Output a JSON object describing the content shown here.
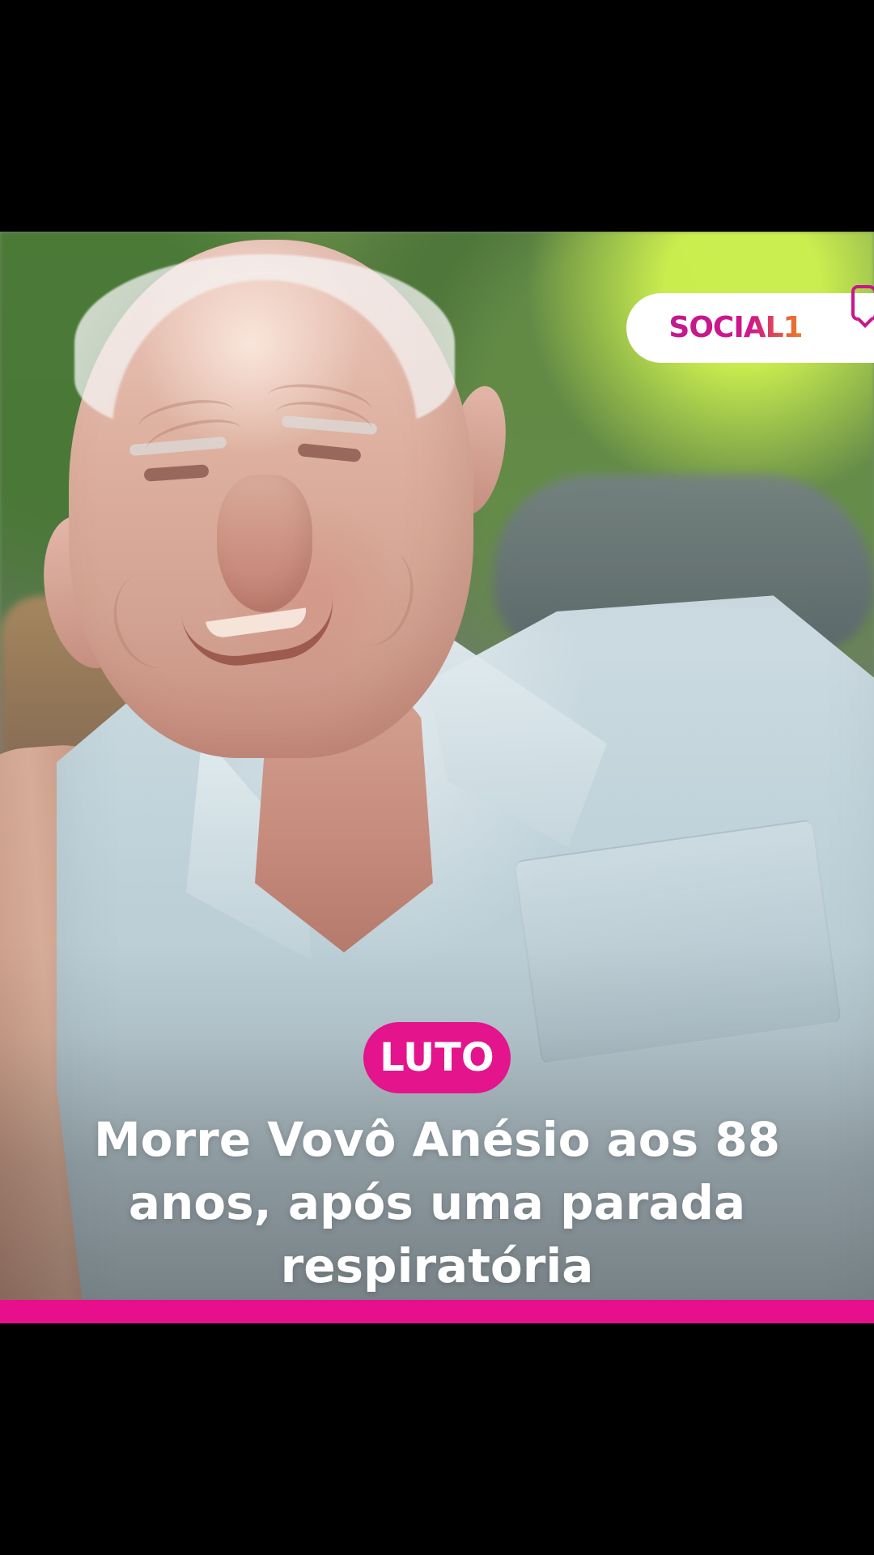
{
  "brand": {
    "name": "SOCIAL1"
  },
  "post": {
    "tag": "LUTO",
    "headline_lines": [
      "Morre Vovô Anésio aos 88",
      "anos, após uma parada",
      "respiratória"
    ]
  },
  "colors": {
    "accent": "#e3148c",
    "accent_secondary": "#f5a000",
    "background": "#000000",
    "text_primary": "#ffffff"
  },
  "icons": {
    "logo_bubble": "chat-bubble-icon"
  }
}
